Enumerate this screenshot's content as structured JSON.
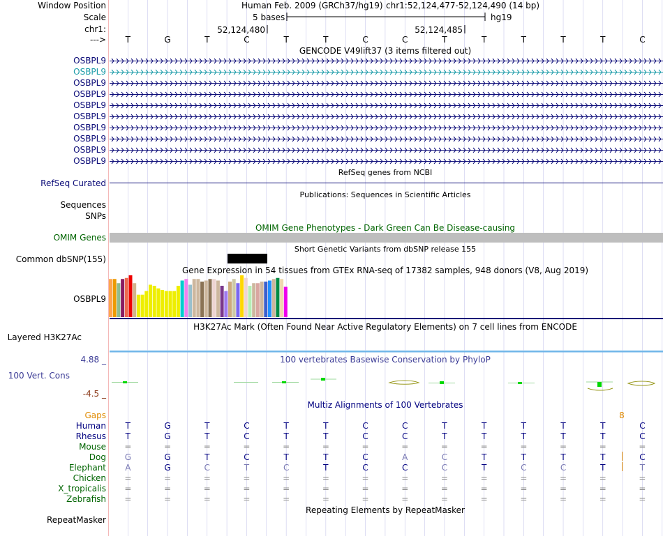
{
  "ruler": {
    "label_window": "Window Position",
    "label_scale": "Scale",
    "label_chr": "chr1:",
    "label_arrow": "--->",
    "assembly": "Human Feb. 2009 (GRCh37/hg19)",
    "position": "chr1:52,124,477-52,124,490 (14 bp)",
    "scale_text": "5 bases",
    "scale_db": "hg19",
    "tick1": "52,124,480",
    "tick2": "52,124,485"
  },
  "bases": [
    "T",
    "G",
    "T",
    "C",
    "T",
    "T",
    "C",
    "C",
    "T",
    "T",
    "T",
    "T",
    "T",
    "C"
  ],
  "gencode": {
    "title": "GENCODE V49lift37 (3 items filtered out)",
    "labels": [
      "OSBPL9",
      "OSBPL9",
      "OSBPL9",
      "OSBPL9",
      "OSBPL9",
      "OSBPL9",
      "OSBPL9",
      "OSBPL9",
      "OSBPL9",
      "OSBPL9"
    ],
    "highlight_index": 1
  },
  "refseq": {
    "title": "RefSeq genes from NCBI",
    "label": "RefSeq Curated"
  },
  "publications": {
    "title": "Publications: Sequences in Scientific Articles",
    "label1": "Sequences",
    "label2": "SNPs"
  },
  "omim": {
    "title": "OMIM Gene Phenotypes - Dark Green Can Be Disease-causing",
    "label": "OMIM Genes"
  },
  "dbsnp": {
    "title": "Short Genetic Variants from dbSNP release 155",
    "label": "Common dbSNP(155)"
  },
  "gtex": {
    "title": "Gene Expression in 54 tissues from GTEx RNA-seq of 17382 samples, 948 donors (V8, Aug 2019)",
    "label": "OSBPL9",
    "bars": [
      {
        "c": "#ffa54f",
        "v": 0.73
      },
      {
        "c": "#ee9a00",
        "v": 0.73
      },
      {
        "c": "#8fbc8f",
        "v": 0.65
      },
      {
        "c": "#8b1c62",
        "v": 0.73
      },
      {
        "c": "#ee6a50",
        "v": 0.75
      },
      {
        "c": "#ee0000",
        "v": 0.8
      },
      {
        "c": "#d2b48c",
        "v": 0.65
      },
      {
        "c": "#eeee00",
        "v": 0.43
      },
      {
        "c": "#eeee00",
        "v": 0.43
      },
      {
        "c": "#eeee00",
        "v": 0.5
      },
      {
        "c": "#eeee00",
        "v": 0.62
      },
      {
        "c": "#eeee00",
        "v": 0.6
      },
      {
        "c": "#eeee00",
        "v": 0.55
      },
      {
        "c": "#eeee00",
        "v": 0.52
      },
      {
        "c": "#eeee00",
        "v": 0.5
      },
      {
        "c": "#eeee00",
        "v": 0.5
      },
      {
        "c": "#eeee00",
        "v": 0.5
      },
      {
        "c": "#eeee00",
        "v": 0.6
      },
      {
        "c": "#00cdcd",
        "v": 0.7
      },
      {
        "c": "#ee82ee",
        "v": 0.73
      },
      {
        "c": "#9ac0cd",
        "v": 0.62
      },
      {
        "c": "#cdb79e",
        "v": 0.73
      },
      {
        "c": "#cdb79e",
        "v": 0.73
      },
      {
        "c": "#8b7355",
        "v": 0.68
      },
      {
        "c": "#cdb79e",
        "v": 0.7
      },
      {
        "c": "#8b7355",
        "v": 0.73
      },
      {
        "c": "#eed5d2",
        "v": 0.73
      },
      {
        "c": "#cdb79e",
        "v": 0.7
      },
      {
        "c": "#7a378b",
        "v": 0.6
      },
      {
        "c": "#9f79ee",
        "v": 0.5
      },
      {
        "c": "#cdaa7d",
        "v": 0.68
      },
      {
        "c": "#cdc9a5",
        "v": 0.73
      },
      {
        "c": "#7a67ee",
        "v": 0.65
      },
      {
        "c": "#ffd700",
        "v": 0.8
      },
      {
        "c": "#eed5d2",
        "v": 0.75
      },
      {
        "c": "#b4eeb4",
        "v": 0.6
      },
      {
        "c": "#cdb79e",
        "v": 0.65
      },
      {
        "c": "#d9a6a1",
        "v": 0.65
      },
      {
        "c": "#cdb79e",
        "v": 0.68
      },
      {
        "c": "#3a5fcd",
        "v": 0.68
      },
      {
        "c": "#1e90ff",
        "v": 0.7
      },
      {
        "c": "#cdb79e",
        "v": 0.73
      },
      {
        "c": "#008b45",
        "v": 0.75
      },
      {
        "c": "#eed8ae",
        "v": 0.73
      },
      {
        "c": "#ee00ee",
        "v": 0.58
      }
    ]
  },
  "h3k27ac": {
    "title": "H3K27Ac Mark (Often Found Near Active Regulatory Elements) on 7 cell lines from ENCODE",
    "label": "Layered H3K27Ac"
  },
  "phylop": {
    "title": "100 vertebrates Basewise Conservation by PhyloP",
    "label": "100 Vert. Cons",
    "ymax": "4.88 _",
    "ymin": "-4.5 _"
  },
  "multiz": {
    "title": "Multiz Alignments of 100 Vertebrates",
    "gaps_label": "Gaps",
    "gap_value": "8",
    "species": [
      {
        "name": "Human",
        "bases": [
          "T",
          "G",
          "T",
          "C",
          "T",
          "T",
          "C",
          "C",
          "T",
          "T",
          "T",
          "T",
          "T",
          "C"
        ]
      },
      {
        "name": "Rhesus",
        "bases": [
          "T",
          "G",
          "T",
          "C",
          "T",
          "T",
          "C",
          "C",
          "T",
          "T",
          "T",
          "T",
          "T",
          "C"
        ]
      },
      {
        "name": "Mouse",
        "bases": [
          "=",
          "=",
          "=",
          "=",
          "=",
          "=",
          "=",
          "=",
          "=",
          "=",
          "=",
          "=",
          "=",
          "="
        ]
      },
      {
        "name": "Dog",
        "bases": [
          "G",
          "G",
          "T",
          "C",
          "T",
          "T",
          "C",
          "A",
          "C",
          "T",
          "T",
          "T",
          "T",
          "C"
        ]
      },
      {
        "name": "Elephant",
        "bases": [
          "A",
          "G",
          "C",
          "T",
          "C",
          "T",
          "C",
          "C",
          "C",
          "T",
          "C",
          "C",
          "T",
          "T"
        ]
      },
      {
        "name": "Chicken",
        "bases": [
          "=",
          "=",
          "=",
          "=",
          "=",
          "=",
          "=",
          "=",
          "=",
          "=",
          "=",
          "=",
          "=",
          "="
        ]
      },
      {
        "name": "X_tropicalis",
        "bases": [
          "=",
          "=",
          "=",
          "=",
          "=",
          "=",
          "=",
          "=",
          "=",
          "=",
          "=",
          "=",
          "=",
          "="
        ]
      },
      {
        "name": "Zebrafish",
        "bases": [
          "=",
          "=",
          "=",
          "=",
          "=",
          "=",
          "=",
          "=",
          "=",
          "=",
          "=",
          "=",
          "=",
          "="
        ]
      }
    ]
  },
  "repeatmasker": {
    "title": "Repeating Elements by RepeatMasker",
    "label": "RepeatMasker"
  },
  "colors": {
    "gene": "#0c0c78",
    "gene_highlight": "#1a9ba8",
    "omim_green": "#006400",
    "phylop_blue": "#3c3c96",
    "phylop_neg": "#8b3a1a",
    "gaps": "#e08a00",
    "species_primate": "#000080",
    "species_other": "#006400",
    "gridline": "#c8c8ec",
    "sidebar_line": "#f4b8b8",
    "h3k27ac_line": "#6cb4e8"
  }
}
